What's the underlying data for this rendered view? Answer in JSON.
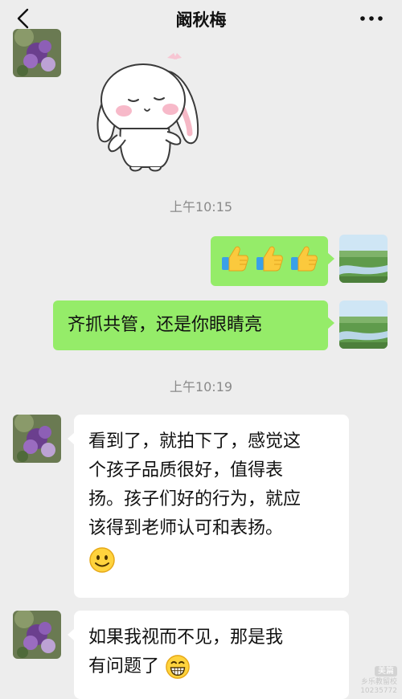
{
  "header": {
    "title": "阚秋梅"
  },
  "icons": {
    "back": "chevron-left-icon",
    "more": "more-dots-icon"
  },
  "colors": {
    "background": "#ededed",
    "outgoing_bubble": "#95ec69",
    "incoming_bubble": "#ffffff",
    "timestamp_text": "#8a8a8a"
  },
  "messages": [
    {
      "sender": "other",
      "type": "sticker",
      "content": "bunny-sticker"
    },
    {
      "type": "timestamp",
      "text": "上午10:15"
    },
    {
      "sender": "me",
      "type": "emoji",
      "content": [
        "thumbs-up",
        "thumbs-up",
        "thumbs-up"
      ]
    },
    {
      "sender": "me",
      "type": "text",
      "text": "齐抓共管，还是你眼睛亮"
    },
    {
      "type": "timestamp",
      "text": "上午10:19"
    },
    {
      "sender": "other",
      "type": "text",
      "lines": [
        "看到了，就拍下了，感觉这",
        "个孩子品质很好，值得表",
        "扬。孩子们好的行为，就应",
        "该得到老师认可和表扬。"
      ],
      "trailing_emoji": "smile"
    },
    {
      "sender": "other",
      "type": "text",
      "lines": [
        "如果我视而不见，那是我",
        "有问题了"
      ],
      "trailing_emoji": "grin"
    }
  ],
  "watermark": {
    "logo": "美篇",
    "line1": "乡乐教留校",
    "line2": "10235772"
  }
}
